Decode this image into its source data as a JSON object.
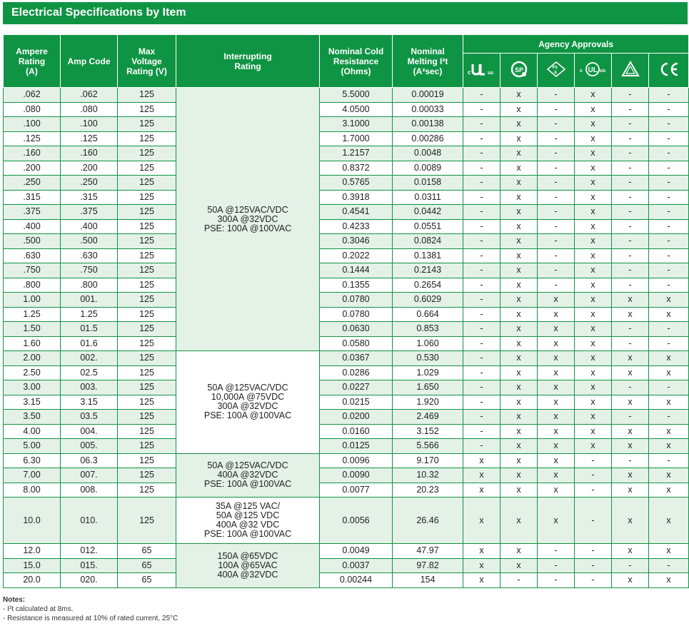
{
  "title": "Electrical Specifications by Item",
  "headers": {
    "ampere_rating": "Ampere Rating (A)",
    "amp_code": "Amp Code",
    "max_voltage": "Max Voltage Rating (V)",
    "interrupting": "Interrupting Rating",
    "cold_resistance": "Nominal Cold Resistance (Ohms)",
    "melting": "Nominal Melting I²t (A²sec)",
    "agency": "Agency Approvals"
  },
  "agency_icons": [
    "cURus-recognized-icon",
    "csa-icon",
    "pse-icon",
    "cULus-listed-icon",
    "triangle-mark-icon",
    "ce-icon"
  ],
  "rows": [
    {
      "a": ".062",
      "code": ".062",
      "v": "125",
      "r": "5.5000",
      "i2t": "0.00019",
      "ag": [
        "-",
        "x",
        "-",
        "x",
        "-",
        "-"
      ]
    },
    {
      "a": ".080",
      "code": ".080",
      "v": "125",
      "r": "4.0500",
      "i2t": "0.00033",
      "ag": [
        "-",
        "x",
        "-",
        "x",
        "-",
        "-"
      ]
    },
    {
      "a": ".100",
      "code": ".100",
      "v": "125",
      "r": "3.1000",
      "i2t": "0.00138",
      "ag": [
        "-",
        "x",
        "-",
        "x",
        "-",
        "-"
      ]
    },
    {
      "a": ".125",
      "code": ".125",
      "v": "125",
      "r": "1.7000",
      "i2t": "0.00286",
      "ag": [
        "-",
        "x",
        "-",
        "x",
        "-",
        "-"
      ]
    },
    {
      "a": ".160",
      "code": ".160",
      "v": "125",
      "r": "1.2157",
      "i2t": "0.0048",
      "ag": [
        "-",
        "x",
        "-",
        "x",
        "-",
        "-"
      ]
    },
    {
      "a": ".200",
      "code": ".200",
      "v": "125",
      "r": "0.8372",
      "i2t": "0.0089",
      "ag": [
        "-",
        "x",
        "-",
        "x",
        "-",
        "-"
      ]
    },
    {
      "a": ".250",
      "code": ".250",
      "v": "125",
      "r": "0.5765",
      "i2t": "0.0158",
      "ag": [
        "-",
        "x",
        "-",
        "x",
        "-",
        "-"
      ]
    },
    {
      "a": ".315",
      "code": ".315",
      "v": "125",
      "r": "0.3918",
      "i2t": "0.0311",
      "ag": [
        "-",
        "x",
        "-",
        "x",
        "-",
        "-"
      ]
    },
    {
      "a": ".375",
      "code": ".375",
      "v": "125",
      "r": "0.4541",
      "i2t": "0.0442",
      "ag": [
        "-",
        "x",
        "-",
        "x",
        "-",
        "-"
      ]
    },
    {
      "a": ".400",
      "code": ".400",
      "v": "125",
      "r": "0.4233",
      "i2t": "0.0551",
      "ag": [
        "-",
        "x",
        "-",
        "x",
        "-",
        "-"
      ]
    },
    {
      "a": ".500",
      "code": ".500",
      "v": "125",
      "r": "0.3046",
      "i2t": "0.0824",
      "ag": [
        "-",
        "x",
        "-",
        "x",
        "-",
        "-"
      ]
    },
    {
      "a": ".630",
      "code": ".630",
      "v": "125",
      "r": "0.2022",
      "i2t": "0.1381",
      "ag": [
        "-",
        "x",
        "-",
        "x",
        "-",
        "-"
      ]
    },
    {
      "a": ".750",
      "code": ".750",
      "v": "125",
      "r": "0.1444",
      "i2t": "0.2143",
      "ag": [
        "-",
        "x",
        "-",
        "x",
        "-",
        "-"
      ]
    },
    {
      "a": ".800",
      "code": ".800",
      "v": "125",
      "r": "0.1355",
      "i2t": "0.2654",
      "ag": [
        "-",
        "x",
        "-",
        "x",
        "-",
        "-"
      ]
    },
    {
      "a": "1.00",
      "code": "001.",
      "v": "125",
      "r": "0.0780",
      "i2t": "0.6029",
      "ag": [
        "-",
        "x",
        "x",
        "x",
        "x",
        "x"
      ]
    },
    {
      "a": "1.25",
      "code": "1.25",
      "v": "125",
      "r": "0.0780",
      "i2t": "0.664",
      "ag": [
        "-",
        "x",
        "x",
        "x",
        "x",
        "x"
      ]
    },
    {
      "a": "1.50",
      "code": "01.5",
      "v": "125",
      "r": "0.0630",
      "i2t": "0.853",
      "ag": [
        "-",
        "x",
        "x",
        "x",
        "-",
        "-"
      ]
    },
    {
      "a": "1.60",
      "code": "01.6",
      "v": "125",
      "r": "0.0580",
      "i2t": "1.060",
      "ag": [
        "-",
        "x",
        "x",
        "x",
        "-",
        "-"
      ]
    },
    {
      "a": "2.00",
      "code": "002.",
      "v": "125",
      "r": "0.0367",
      "i2t": "0.530",
      "ag": [
        "-",
        "x",
        "x",
        "x",
        "x",
        "x"
      ]
    },
    {
      "a": "2.50",
      "code": "02.5",
      "v": "125",
      "r": "0.0286",
      "i2t": "1.029",
      "ag": [
        "-",
        "x",
        "x",
        "x",
        "x",
        "x"
      ]
    },
    {
      "a": "3.00",
      "code": "003.",
      "v": "125",
      "r": "0.0227",
      "i2t": "1.650",
      "ag": [
        "-",
        "x",
        "x",
        "x",
        "-",
        "-"
      ]
    },
    {
      "a": "3.15",
      "code": "3.15",
      "v": "125",
      "r": "0.0215",
      "i2t": "1.920",
      "ag": [
        "-",
        "x",
        "x",
        "x",
        "x",
        "x"
      ]
    },
    {
      "a": "3.50",
      "code": "03.5",
      "v": "125",
      "r": "0.0200",
      "i2t": "2.469",
      "ag": [
        "-",
        "x",
        "x",
        "x",
        "-",
        "-"
      ]
    },
    {
      "a": "4.00",
      "code": "004.",
      "v": "125",
      "r": "0.0160",
      "i2t": "3.152",
      "ag": [
        "-",
        "x",
        "x",
        "x",
        "x",
        "x"
      ]
    },
    {
      "a": "5.00",
      "code": "005.",
      "v": "125",
      "r": "0.0125",
      "i2t": "5.566",
      "ag": [
        "-",
        "x",
        "x",
        "x",
        "x",
        "x"
      ]
    },
    {
      "a": "6.30",
      "code": "06.3",
      "v": "125",
      "r": "0.0096",
      "i2t": "9.170",
      "ag": [
        "x",
        "x",
        "x",
        "-",
        "-",
        "-"
      ]
    },
    {
      "a": "7.00",
      "code": "007.",
      "v": "125",
      "r": "0.0090",
      "i2t": "10.32",
      "ag": [
        "x",
        "x",
        "x",
        "-",
        "x",
        "x"
      ]
    },
    {
      "a": "8.00",
      "code": "008.",
      "v": "125",
      "r": "0.0077",
      "i2t": "20.23",
      "ag": [
        "x",
        "x",
        "x",
        "-",
        "x",
        "x"
      ]
    },
    {
      "a": "10.0",
      "code": "010.",
      "v": "125",
      "r": "0.0056",
      "i2t": "26.46",
      "ag": [
        "x",
        "x",
        "x",
        "-",
        "x",
        "x"
      ]
    },
    {
      "a": "12.0",
      "code": "012.",
      "v": "65",
      "r": "0.0049",
      "i2t": "47.97",
      "ag": [
        "x",
        "x",
        "-",
        "-",
        "x",
        "x"
      ]
    },
    {
      "a": "15.0",
      "code": "015.",
      "v": "65",
      "r": "0.0037",
      "i2t": "97.82",
      "ag": [
        "x",
        "x",
        "-",
        "-",
        "-",
        "-"
      ]
    },
    {
      "a": "20.0",
      "code": "020.",
      "v": "65",
      "r": "0.00244",
      "i2t": "154",
      "ag": [
        "x",
        "-",
        "-",
        "-",
        "x",
        "x"
      ]
    }
  ],
  "interrupting_groups": [
    {
      "start": 0,
      "span": 18,
      "lines": [
        "50A @125VAC/VDC",
        "300A @32VDC",
        "PSE: 100A @100VAC"
      ]
    },
    {
      "start": 18,
      "span": 7,
      "lines": [
        "50A @125VAC/VDC",
        "10,000A @75VDC",
        "300A @32VDC",
        "PSE: 100A @100VAC"
      ]
    },
    {
      "start": 25,
      "span": 3,
      "lines": [
        "50A @125VAC/VDC",
        "400A @32VDC",
        "PSE: 100A @100VAC"
      ]
    },
    {
      "start": 28,
      "span": 1,
      "lines": [
        "35A @125 VAC/",
        "50A @125 VDC",
        "400A @32 VDC",
        "PSE: 100A @100VAC"
      ]
    },
    {
      "start": 29,
      "span": 3,
      "lines": [
        "150A @65VDC",
        "100A @65VAC",
        "400A @32VDC"
      ]
    }
  ],
  "notes": {
    "title": "Notes:",
    "lines": [
      "- I²t calculated at 8ms.",
      "- Resistance is measured at 10% of rated current, 25°C"
    ]
  }
}
